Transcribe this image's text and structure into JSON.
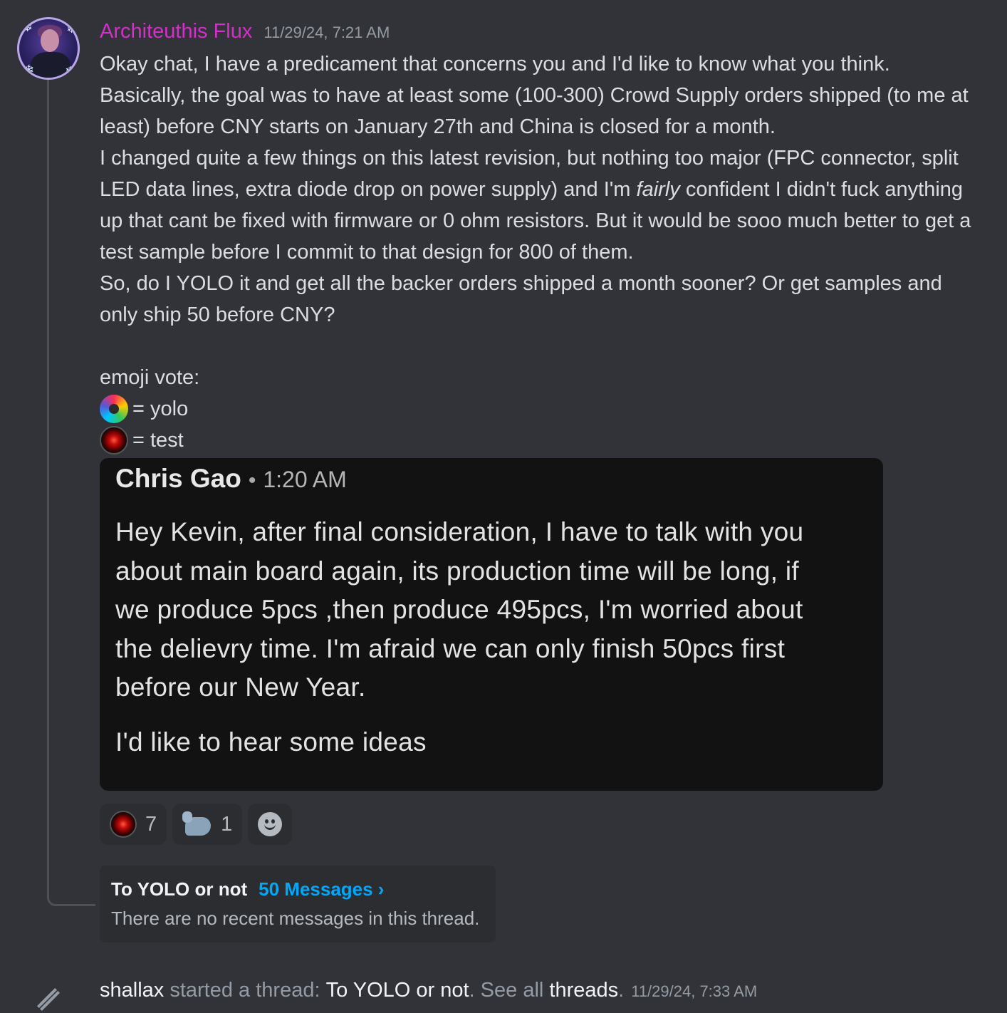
{
  "message": {
    "author": "Architeuthis Flux",
    "timestamp": "11/29/24, 7:21 AM",
    "paragraphs": [
      "Okay chat, I have a predicament that concerns you and I'd like to know what you think.",
      "Basically, the goal was to have at least some (100-300) Crowd Supply orders shipped (to me at least) before CNY starts on January 27th and China is closed for a month.",
      "I changed quite a few things on this latest revision, but nothing too major (FPC connector, split LED data lines, extra diode drop on power supply) and I'm",
      "fairly",
      "confident I didn't fuck anything up that cant be fixed with firmware or 0 ohm resistors. But it would be sooo much better to get a test sample before I commit to that design for 800 of them.",
      "So, do I YOLO it and get all the backer orders shipped a month sooner? Or get samples and only ship 50 before CNY?"
    ],
    "vote_heading": "emoji vote:",
    "vote_options": [
      "= yolo",
      "= test"
    ]
  },
  "embed": {
    "name": "Chris Gao",
    "separator": "•",
    "time": "1:20 AM",
    "lines": [
      "Hey Kevin, after final consideration, I have to talk with you",
      "about main board again, its production time will be long, if",
      "we produce 5pcs ,then produce 495pcs, I'm worried about",
      "the delievry time.  I'm afraid we can only finish 50pcs first",
      "before  our New Year."
    ],
    "closing": "I'd like to hear some ideas"
  },
  "reactions": [
    {
      "emoji": "hal-9000-emoji",
      "count": "7"
    },
    {
      "emoji": "flexed-biceps-emoji",
      "count": "1"
    }
  ],
  "thread": {
    "name": "To YOLO or not",
    "count_label": "50 Messages ›",
    "empty_text": "There are no recent messages in this thread."
  },
  "system": {
    "user": "shallax",
    "text1": "started a thread:",
    "thread": "To YOLO or not",
    "text2": ". See all",
    "link": "threads",
    "text3": ".",
    "timestamp": "11/29/24, 7:33 AM"
  }
}
